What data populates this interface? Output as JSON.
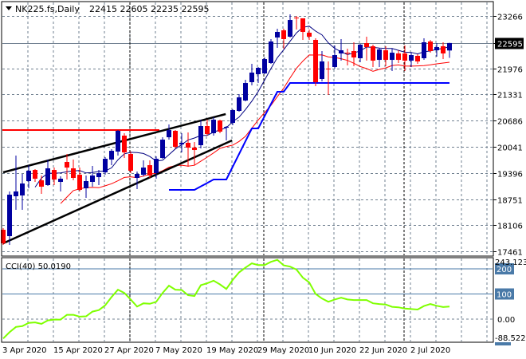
{
  "header": {
    "symbol_timeframe": "NK225.fs,Daily",
    "ohlc": "22415 22605 22235 22595",
    "menu_icon": "triangle-down-icon"
  },
  "colors": {
    "bull": "#0000a0",
    "bear": "#ff0000",
    "ma_fast": "#000080",
    "ma_slow": "#ff0000",
    "stop_line": "#0000ff",
    "resistance": "#ff0000",
    "trendline": "#000000",
    "cci": "#7fff00",
    "cci_level": "#4a7aa8",
    "grid": "#708090"
  },
  "chart_data": [
    {
      "type": "candlestick",
      "title": "NK225.fs,Daily",
      "y_ticks": [
        23266,
        22595,
        21976,
        21331,
        20686,
        20041,
        19396,
        18751,
        18106,
        17461
      ],
      "current_price": "22595",
      "x_tick_labels": [
        "3 Apr 2020",
        "15 Apr 2020",
        "27 Apr 2020",
        "7 May 2020",
        "19 May 2020",
        "29 May 2020",
        "10 Jun 2020",
        "22 Jun 2020",
        "2 Jul 2020"
      ],
      "grid": true,
      "ohlc": [
        [
          17997,
          18036,
          17623,
          17663
        ],
        [
          17840,
          18941,
          17623,
          18862
        ],
        [
          18823,
          19825,
          18488,
          18941
        ],
        [
          18842,
          19373,
          18488,
          19137
        ],
        [
          19196,
          19589,
          19019,
          19452
        ],
        [
          19471,
          19491,
          19177,
          19255
        ],
        [
          19216,
          19334,
          18882,
          19059
        ],
        [
          19098,
          19727,
          19078,
          19511
        ],
        [
          19471,
          19530,
          19098,
          19235
        ],
        [
          19177,
          19314,
          18941,
          19255
        ],
        [
          19668,
          19865,
          19235,
          19530
        ],
        [
          19511,
          19727,
          19216,
          19275
        ],
        [
          19353,
          19530,
          18941,
          18980
        ],
        [
          19019,
          19334,
          18783,
          19196
        ],
        [
          19177,
          19570,
          19059,
          19334
        ],
        [
          19294,
          19471,
          19098,
          19393
        ],
        [
          19412,
          19786,
          19353,
          19747
        ],
        [
          19727,
          19983,
          19589,
          19943
        ],
        [
          19924,
          20454,
          19825,
          20435
        ],
        [
          20317,
          20376,
          19766,
          19904
        ],
        [
          19865,
          19924,
          19393,
          19452
        ],
        [
          19275,
          19432,
          19000,
          19373
        ],
        [
          19353,
          19707,
          19314,
          19530
        ],
        [
          19589,
          19707,
          19275,
          19334
        ],
        [
          19393,
          19806,
          19255,
          19747
        ],
        [
          19766,
          20277,
          19747,
          20218
        ],
        [
          20277,
          20592,
          20218,
          20454
        ],
        [
          20435,
          20454,
          20002,
          20042
        ],
        [
          20101,
          20376,
          19904,
          20140
        ],
        [
          20140,
          20395,
          19550,
          20022
        ],
        [
          20022,
          20160,
          19589,
          19963
        ],
        [
          20081,
          20710,
          20002,
          20553
        ],
        [
          20553,
          20710,
          20317,
          20356
        ],
        [
          20376,
          20769,
          20317,
          20710
        ],
        [
          20690,
          20710,
          20376,
          20415
        ],
        [
          20513,
          20553,
          20199,
          20533
        ],
        [
          20631,
          20966,
          20572,
          20946
        ],
        [
          20926,
          21339,
          20907,
          21260
        ],
        [
          21182,
          21693,
          21162,
          21614
        ],
        [
          21634,
          22086,
          21555,
          21870
        ],
        [
          21831,
          22008,
          21614,
          21988
        ],
        [
          21850,
          22243,
          21831,
          22204
        ],
        [
          22106,
          22696,
          22086,
          22637
        ],
        [
          22735,
          22951,
          22479,
          22873
        ],
        [
          22912,
          22951,
          22460,
          22696
        ],
        [
          22755,
          23305,
          22735,
          23167
        ],
        [
          23226,
          23266,
          22932,
          23207
        ],
        [
          23207,
          23207,
          22676,
          22873
        ],
        [
          22853,
          22932,
          22676,
          22755
        ],
        [
          22676,
          22715,
          21536,
          21634
        ],
        [
          21713,
          22401,
          21654,
          22145
        ],
        [
          21968,
          22145,
          21319,
          21949
        ],
        [
          22008,
          22538,
          21968,
          22302
        ],
        [
          22342,
          22696,
          22165,
          22420
        ],
        [
          22361,
          22460,
          22047,
          22342
        ],
        [
          22401,
          22617,
          22027,
          22243
        ],
        [
          22224,
          22578,
          22126,
          22558
        ],
        [
          22597,
          22755,
          22165,
          22499
        ],
        [
          22519,
          22558,
          22008,
          22165
        ],
        [
          22184,
          22479,
          22008,
          22440
        ],
        [
          22420,
          22519,
          22027,
          22184
        ],
        [
          22184,
          22460,
          21909,
          22361
        ],
        [
          22342,
          22420,
          22106,
          22184
        ],
        [
          22342,
          22538,
          21909,
          22165
        ],
        [
          22165,
          22361,
          22008,
          22302
        ],
        [
          22283,
          22322,
          22086,
          22145
        ],
        [
          22224,
          22715,
          22184,
          22617
        ],
        [
          22637,
          22676,
          22361,
          22401
        ],
        [
          22420,
          22597,
          22263,
          22499
        ],
        [
          22519,
          22617,
          22204,
          22342
        ],
        [
          22415,
          22605,
          22235,
          22599
        ]
      ],
      "stop_line": [
        [
          26,
          18980
        ],
        [
          30,
          18980
        ],
        [
          33,
          19235
        ],
        [
          35,
          19235
        ],
        [
          39,
          20494
        ],
        [
          40,
          20494
        ],
        [
          43,
          21398
        ],
        [
          44,
          21398
        ],
        [
          45,
          21614
        ],
        [
          70,
          21614
        ]
      ],
      "resistance_line": {
        "price": 20454,
        "from_bar": 0,
        "to_bar": 24.5
      },
      "trendlines": [
        {
          "from": [
            0,
            19413
          ],
          "to": [
            34.9,
            20848
          ]
        },
        {
          "from": [
            0,
            17663
          ],
          "to": [
            35.9,
            20199
          ]
        }
      ]
    },
    {
      "type": "line",
      "label": "CCI(40) 50.0190",
      "y_max_label": "243.1235",
      "y_min_label": "-88.5221",
      "levels": [
        "200",
        "100",
        "0.00"
      ],
      "values": [
        -77,
        -52,
        -31,
        -28,
        -15,
        -13,
        -19,
        -5,
        -2,
        -2,
        17,
        17,
        10,
        11,
        30,
        36,
        55,
        88,
        117,
        104,
        78,
        50,
        63,
        61,
        69,
        104,
        133,
        117,
        116,
        95,
        92,
        135,
        143,
        153,
        138,
        120,
        156,
        186,
        205,
        222,
        215,
        215,
        228,
        236,
        214,
        209,
        197,
        165,
        146,
        100,
        82,
        69,
        78,
        85,
        78,
        76,
        76,
        76,
        63,
        60,
        58,
        49,
        47,
        42,
        40,
        38,
        52,
        60,
        53,
        48,
        50.019
      ]
    }
  ]
}
